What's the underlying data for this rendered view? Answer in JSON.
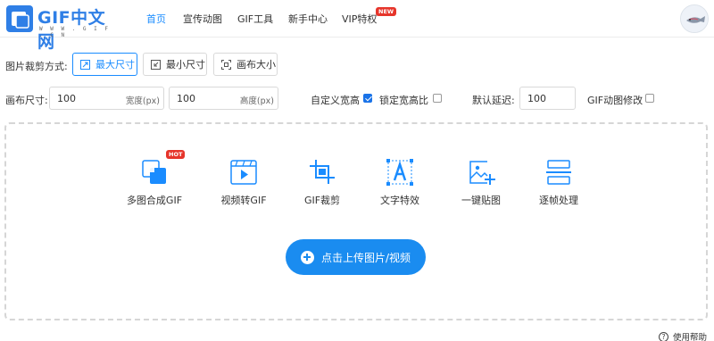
{
  "logo": {
    "text": "GIF中文网",
    "sub": "W W W . G I F . C N"
  },
  "nav": [
    {
      "label": "首页",
      "active": true
    },
    {
      "label": "宣传动图",
      "active": false
    },
    {
      "label": "GIF工具",
      "active": false
    },
    {
      "label": "新手中心",
      "active": false
    },
    {
      "label": "VIP特权",
      "active": false,
      "badge": "NEW"
    }
  ],
  "crop": {
    "label": "图片裁剪方式:",
    "modes": [
      {
        "label": "最大尺寸",
        "icon": "max-size-icon",
        "active": true
      },
      {
        "label": "最小尺寸",
        "icon": "min-size-icon",
        "active": false
      },
      {
        "label": "画布大小",
        "icon": "canvas-size-icon",
        "active": false
      }
    ]
  },
  "size": {
    "label": "画布尺寸:",
    "width": {
      "value": "100",
      "unit": "宽度(px)"
    },
    "height": {
      "value": "100",
      "unit": "高度(px)"
    },
    "custom_label": "自定义宽高",
    "custom_checked": true,
    "lock_label": "锁定宽高比",
    "lock_checked": false,
    "delay_label": "默认延迟:",
    "delay_value": "100",
    "gif_label": "GIF动图修改",
    "gif_checked": false
  },
  "tools": [
    {
      "label": "多图合成GIF",
      "icon": "multi-image-gif-icon",
      "badge": "HOT"
    },
    {
      "label": "视频转GIF",
      "icon": "video-to-gif-icon"
    },
    {
      "label": "GIF裁剪",
      "icon": "crop-icon"
    },
    {
      "label": "文字特效",
      "icon": "text-effect-icon"
    },
    {
      "label": "一键贴图",
      "icon": "sticker-icon"
    },
    {
      "label": "逐帧处理",
      "icon": "frame-edit-icon"
    }
  ],
  "upload": {
    "label": "点击上传图片/视频"
  },
  "help": {
    "label": "使用帮助"
  },
  "colors": {
    "accent": "#1a8cff",
    "upload": "#1a8cf0",
    "badge": "#e6352b",
    "logo": "#2f7fe6"
  }
}
